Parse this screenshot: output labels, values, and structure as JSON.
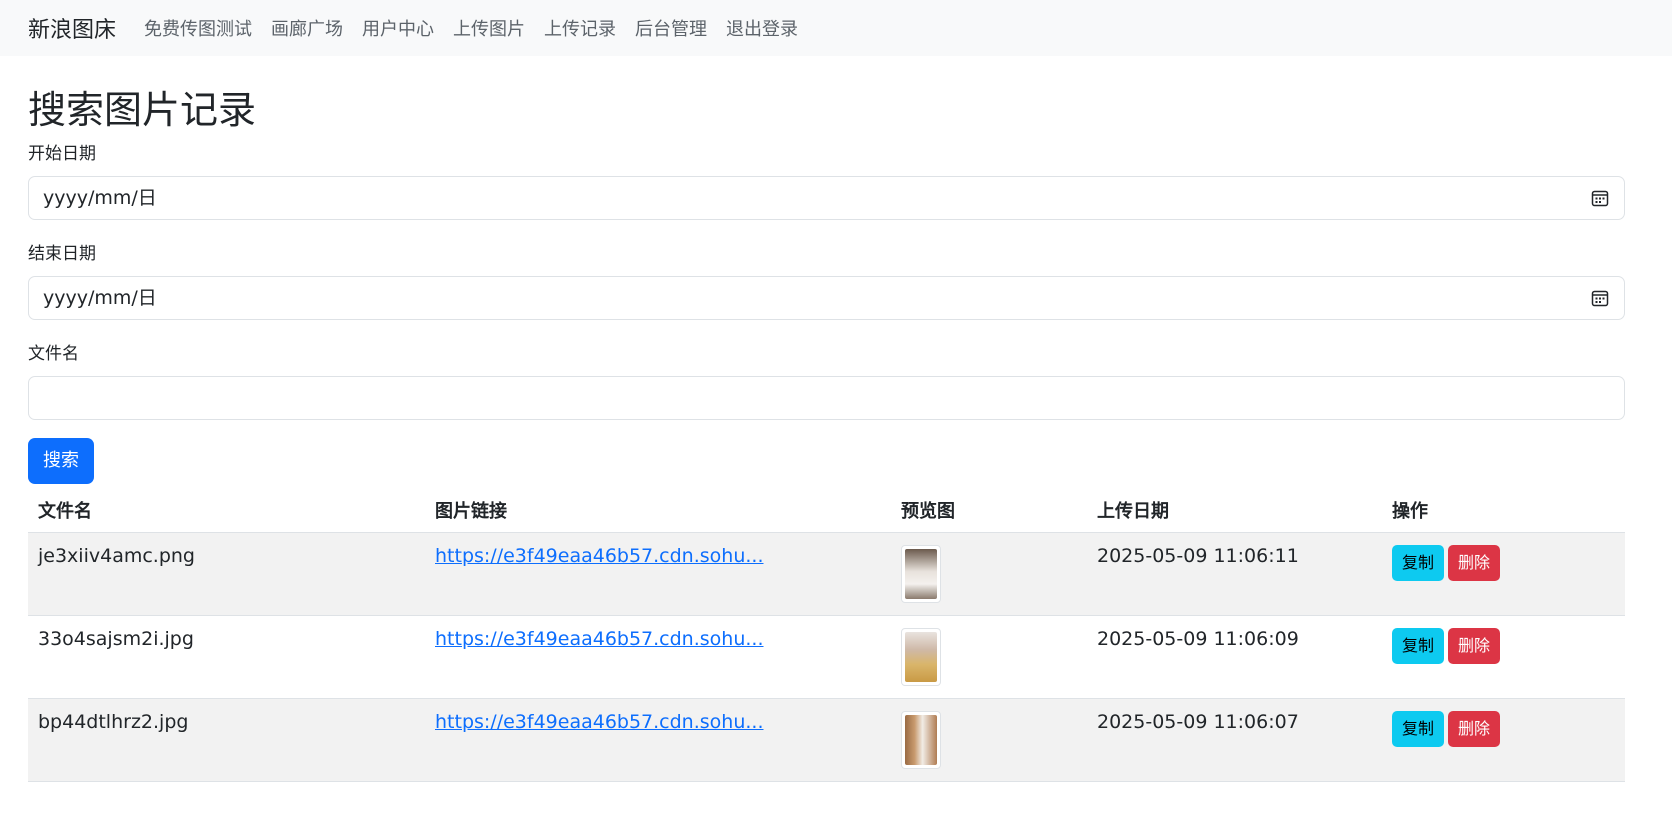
{
  "navbar": {
    "brand": "新浪图床",
    "links": [
      "免费传图测试",
      "画廊广场",
      "用户中心",
      "上传图片",
      "上传记录",
      "后台管理",
      "退出登录"
    ]
  },
  "page": {
    "title": "搜索图片记录",
    "start_date_label": "开始日期",
    "start_date_value": "yyyy/mm/日",
    "end_date_label": "结束日期",
    "end_date_value": "yyyy/mm/日",
    "filename_label": "文件名",
    "filename_value": "",
    "search_button": "搜索"
  },
  "table": {
    "headers": [
      "文件名",
      "图片链接",
      "预览图",
      "上传日期",
      "操作"
    ],
    "rows": [
      {
        "filename": "je3xiiv4amc.png",
        "link": "https://e3f49eaa46b57.cdn.sohu...",
        "date": "2025-05-09 11:06:11",
        "copy": "复制",
        "delete": "删除"
      },
      {
        "filename": "33o4sajsm2i.jpg",
        "link": "https://e3f49eaa46b57.cdn.sohu...",
        "date": "2025-05-09 11:06:09",
        "copy": "复制",
        "delete": "删除"
      },
      {
        "filename": "bp44dtlhrz2.jpg",
        "link": "https://e3f49eaa46b57.cdn.sohu...",
        "date": "2025-05-09 11:06:07",
        "copy": "复制",
        "delete": "删除"
      }
    ]
  },
  "colors": {
    "primary": "#0d6efd",
    "info": "#0dcaf0",
    "danger": "#dc3545",
    "navbar_bg": "#f8f9fa"
  }
}
